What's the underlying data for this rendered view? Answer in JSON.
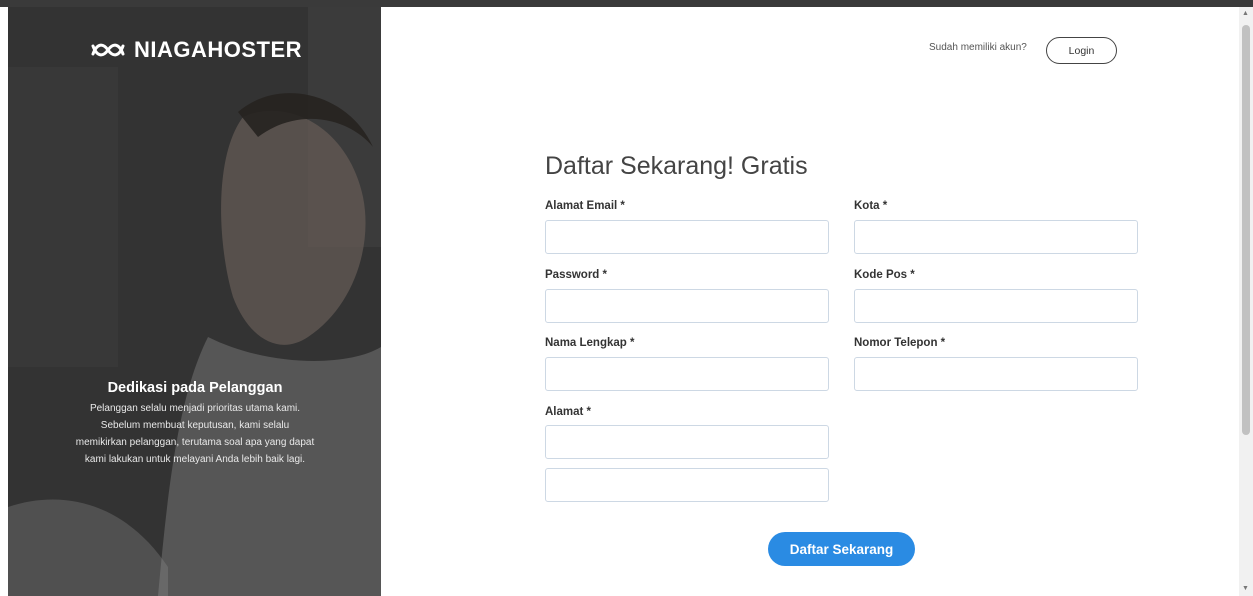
{
  "brand": {
    "name": "NIAGAHOSTER",
    "logo_icon": "infinity-wave-icon"
  },
  "promo": {
    "title": "Dedikasi pada Pelanggan",
    "lines": [
      "Pelanggan selalu menjadi prioritas utama kami.",
      "Sebelum membuat keputusan, kami selalu",
      "memikirkan pelanggan, terutama soal apa yang dapat",
      "kami lakukan untuk melayani Anda lebih baik lagi."
    ]
  },
  "header": {
    "have_account_text": "Sudah memiliki akun?",
    "login_label": "Login"
  },
  "form": {
    "title": "Daftar Sekarang! Gratis",
    "fields": {
      "email": {
        "label": "Alamat Email *",
        "value": ""
      },
      "password": {
        "label": "Password *",
        "value": ""
      },
      "name": {
        "label": "Nama Lengkap *",
        "value": ""
      },
      "address": {
        "label": "Alamat *",
        "value_line1": "",
        "value_line2": ""
      },
      "city": {
        "label": "Kota *",
        "value": ""
      },
      "postal": {
        "label": "Kode Pos *",
        "value": ""
      },
      "phone": {
        "label": "Nomor Telepon *",
        "value": ""
      }
    },
    "submit_label": "Daftar Sekarang"
  },
  "colors": {
    "accent": "#2a8be3",
    "input_border": "#cdd8e4",
    "panel_dark": "#3a3a3a"
  }
}
